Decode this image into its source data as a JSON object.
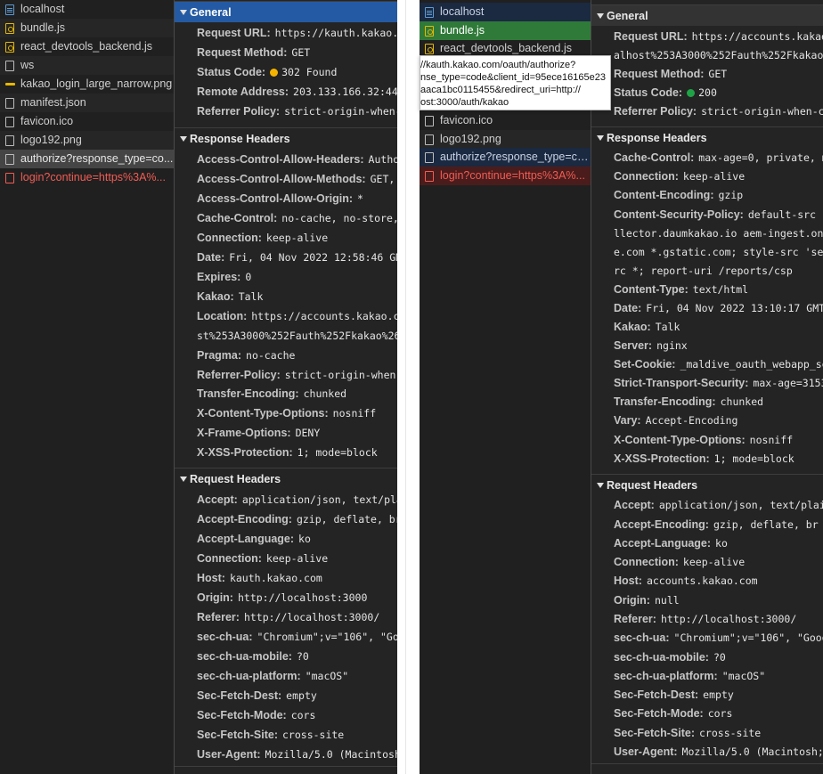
{
  "left": {
    "files": [
      {
        "name": "localhost",
        "icon": "document-icon",
        "kind": "doc"
      },
      {
        "name": "bundle.js",
        "icon": "script-icon",
        "kind": "js"
      },
      {
        "name": "react_devtools_backend.js",
        "icon": "script-icon",
        "kind": "js"
      },
      {
        "name": "ws",
        "icon": "file-icon",
        "kind": "plain"
      },
      {
        "name": "kakao_login_large_narrow.png",
        "icon": "image-icon",
        "kind": "img"
      },
      {
        "name": "manifest.json",
        "icon": "file-icon",
        "kind": "plain"
      },
      {
        "name": "favicon.ico",
        "icon": "file-icon",
        "kind": "plain"
      },
      {
        "name": "logo192.png",
        "icon": "file-icon",
        "kind": "plain"
      },
      {
        "name": "authorize?response_type=co...",
        "icon": "file-icon",
        "kind": "plain"
      },
      {
        "name": "login?continue=https%3A%...",
        "icon": "file-icon",
        "kind": "red"
      }
    ],
    "general": {
      "title": "General",
      "rows": [
        {
          "key": "Request URL:",
          "value": "https://kauth.kakao.c"
        },
        {
          "key": "Request Method:",
          "value": "GET"
        },
        {
          "key": "Status Code:",
          "value": "302 Found",
          "status_color": "#f5b400"
        },
        {
          "key": "Remote Address:",
          "value": "203.133.166.32:443"
        },
        {
          "key": "Referrer Policy:",
          "value": "strict-origin-when-c"
        }
      ]
    },
    "response": {
      "title": "Response Headers",
      "rows": [
        {
          "key": "Access-Control-Allow-Headers:",
          "value": "Author"
        },
        {
          "key": "Access-Control-Allow-Methods:",
          "value": "GET, "
        },
        {
          "key": "Access-Control-Allow-Origin:",
          "value": "*"
        },
        {
          "key": "Cache-Control:",
          "value": "no-cache, no-store,"
        },
        {
          "key": "Connection:",
          "value": "keep-alive"
        },
        {
          "key": "Date:",
          "value": "Fri, 04 Nov 2022 12:58:46 GMT"
        },
        {
          "key": "Expires:",
          "value": "0"
        },
        {
          "key": "Kakao:",
          "value": "Talk"
        },
        {
          "key": "Location:",
          "value": "https://accounts.kakao.co"
        },
        {
          "key": "",
          "value": "st%253A3000%252Fauth%252Fkakao%26t"
        },
        {
          "key": "Pragma:",
          "value": "no-cache"
        },
        {
          "key": "Referrer-Policy:",
          "value": "strict-origin-when-c"
        },
        {
          "key": "Transfer-Encoding:",
          "value": "chunked"
        },
        {
          "key": "X-Content-Type-Options:",
          "value": "nosniff"
        },
        {
          "key": "X-Frame-Options:",
          "value": "DENY"
        },
        {
          "key": "X-XSS-Protection:",
          "value": "1; mode=block"
        }
      ]
    },
    "request": {
      "title": "Request Headers",
      "rows": [
        {
          "key": "Accept:",
          "value": "application/json, text/plai"
        },
        {
          "key": "Accept-Encoding:",
          "value": "gzip, deflate, br"
        },
        {
          "key": "Accept-Language:",
          "value": "ko"
        },
        {
          "key": "Connection:",
          "value": "keep-alive"
        },
        {
          "key": "Host:",
          "value": "kauth.kakao.com"
        },
        {
          "key": "Origin:",
          "value": "http://localhost:3000"
        },
        {
          "key": "Referer:",
          "value": "http://localhost:3000/"
        },
        {
          "key": "sec-ch-ua:",
          "value": "\"Chromium\";v=\"106\", \"Goo"
        },
        {
          "key": "sec-ch-ua-mobile:",
          "value": "?0"
        },
        {
          "key": "sec-ch-ua-platform:",
          "value": "\"macOS\""
        },
        {
          "key": "Sec-Fetch-Dest:",
          "value": "empty"
        },
        {
          "key": "Sec-Fetch-Mode:",
          "value": "cors"
        },
        {
          "key": "Sec-Fetch-Site:",
          "value": "cross-site"
        },
        {
          "key": "User-Agent:",
          "value": "Mozilla/5.0 (Macintosh;"
        }
      ]
    }
  },
  "right": {
    "files": [
      {
        "name": "localhost",
        "icon": "document-icon",
        "kind": "doc"
      },
      {
        "name": "bundle.js",
        "icon": "script-icon",
        "kind": "js"
      },
      {
        "name": "react_devtools_backend.js",
        "icon": "script-icon",
        "kind": "js"
      },
      {
        "name": "favicon.ico",
        "icon": "file-icon",
        "kind": "plain"
      },
      {
        "name": "logo192.png",
        "icon": "file-icon",
        "kind": "plain"
      },
      {
        "name": "authorize?response_type=co...",
        "icon": "file-icon",
        "kind": "plain"
      },
      {
        "name": "login?continue=https%3A%...",
        "icon": "file-icon",
        "kind": "red"
      }
    ],
    "tooltip": {
      "lines": [
        "//kauth.kakao.com/oauth/authorize?",
        "nse_type=code&client_id=95ece16165e23",
        "aaca1bc0115455&redirect_uri=http://",
        "ost:3000/auth/kakao"
      ]
    },
    "general": {
      "title": "General",
      "rows": [
        {
          "key": "Request URL:",
          "value": "https://accounts.kakao.c"
        },
        {
          "key": "",
          "value": "alhost%253A3000%252Fauth%252Fkakao%26"
        },
        {
          "key": "Request Method:",
          "value": "GET"
        },
        {
          "key": "Status Code:",
          "value": "200",
          "status_color": "#1ea446"
        },
        {
          "key": "Referrer Policy:",
          "value": "strict-origin-when-cro"
        }
      ]
    },
    "response": {
      "title": "Response Headers",
      "rows": [
        {
          "key": "Cache-Control:",
          "value": "max-age=0, private, mus"
        },
        {
          "key": "Connection:",
          "value": "keep-alive"
        },
        {
          "key": "Content-Encoding:",
          "value": "gzip"
        },
        {
          "key": "Content-Security-Policy:",
          "value": "default-src 'se"
        },
        {
          "key": "",
          "value": "llector.daumkakao.io aem-ingest.onkak"
        },
        {
          "key": "",
          "value": "e.com *.gstatic.com; style-src 'self'"
        },
        {
          "key": "",
          "value": "rc *; report-uri /reports/csp"
        },
        {
          "key": "Content-Type:",
          "value": "text/html"
        },
        {
          "key": "Date:",
          "value": "Fri, 04 Nov 2022 13:10:17 GMT"
        },
        {
          "key": "Kakao:",
          "value": "Talk"
        },
        {
          "key": "Server:",
          "value": "nginx"
        },
        {
          "key": "Set-Cookie:",
          "value": "_maldive_oauth_webapp_ses"
        },
        {
          "key": "Strict-Transport-Security:",
          "value": "max-age=315360"
        },
        {
          "key": "Transfer-Encoding:",
          "value": "chunked"
        },
        {
          "key": "Vary:",
          "value": "Accept-Encoding"
        },
        {
          "key": "X-Content-Type-Options:",
          "value": "nosniff"
        },
        {
          "key": "X-XSS-Protection:",
          "value": "1; mode=block"
        }
      ]
    },
    "request": {
      "title": "Request Headers",
      "rows": [
        {
          "key": "Accept:",
          "value": "application/json, text/plain,"
        },
        {
          "key": "Accept-Encoding:",
          "value": "gzip, deflate, br"
        },
        {
          "key": "Accept-Language:",
          "value": "ko"
        },
        {
          "key": "Connection:",
          "value": "keep-alive"
        },
        {
          "key": "Host:",
          "value": "accounts.kakao.com"
        },
        {
          "key": "Origin:",
          "value": "null"
        },
        {
          "key": "Referer:",
          "value": "http://localhost:3000/"
        },
        {
          "key": "sec-ch-ua:",
          "value": "\"Chromium\";v=\"106\", \"Google"
        },
        {
          "key": "sec-ch-ua-mobile:",
          "value": "?0"
        },
        {
          "key": "sec-ch-ua-platform:",
          "value": "\"macOS\""
        },
        {
          "key": "Sec-Fetch-Dest:",
          "value": "empty"
        },
        {
          "key": "Sec-Fetch-Mode:",
          "value": "cors"
        },
        {
          "key": "Sec-Fetch-Site:",
          "value": "cross-site"
        },
        {
          "key": "User-Agent:",
          "value": "Mozilla/5.0 (Macintosh; I"
        }
      ]
    }
  }
}
